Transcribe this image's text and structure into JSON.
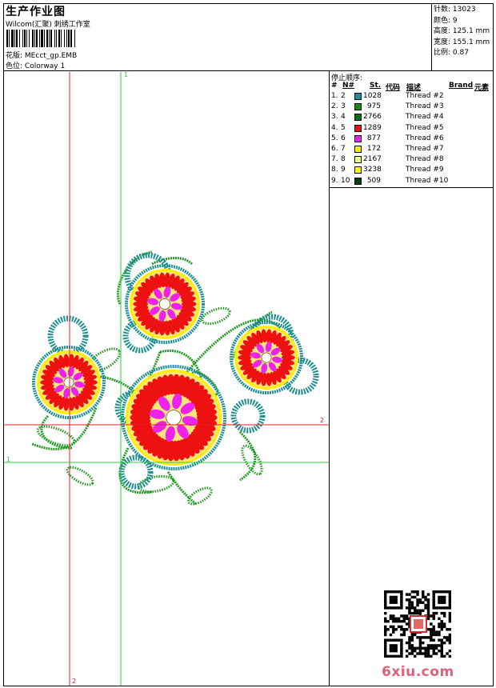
{
  "header": {
    "title": "生产作业图",
    "company": "Wilcom(汇聚) 刺绣工作室",
    "design_label": "花版:",
    "design_value": "MEcct_gp.EMB",
    "colorway_label": "色位:",
    "colorway_value": "Colorway 1"
  },
  "stats": [
    {
      "label": "针数:",
      "value": "13023"
    },
    {
      "label": "颜色:",
      "value": "9"
    },
    {
      "label": "高度:",
      "value": "125.1 mm"
    },
    {
      "label": "宽度:",
      "value": "155.1 mm"
    },
    {
      "label": "比例:",
      "value": "0.87"
    }
  ],
  "stop_sequence": {
    "title": "停止顺序:",
    "columns": {
      "stop": "#",
      "needle": "N#",
      "stitches": "St.",
      "code": "代码",
      "description": "描述",
      "brand": "Brand",
      "element": "元素"
    },
    "rows": [
      {
        "stop": "1.",
        "needle": "2",
        "color": "#1f8f8f",
        "stitches": "1028",
        "description": "Thread #2"
      },
      {
        "stop": "2.",
        "needle": "3",
        "color": "#1a8a1a",
        "stitches": "975",
        "description": "Thread #3"
      },
      {
        "stop": "3.",
        "needle": "4",
        "color": "#0f6e14",
        "stitches": "2766",
        "description": "Thread #4"
      },
      {
        "stop": "4.",
        "needle": "5",
        "color": "#ee1111",
        "stitches": "1289",
        "description": "Thread #5"
      },
      {
        "stop": "5.",
        "needle": "6",
        "color": "#ee22ee",
        "stitches": "877",
        "description": "Thread #6"
      },
      {
        "stop": "6.",
        "needle": "7",
        "color": "#ffee00",
        "stitches": "172",
        "description": "Thread #7"
      },
      {
        "stop": "7.",
        "needle": "8",
        "color": "#ffff88",
        "stitches": "2167",
        "description": "Thread #8"
      },
      {
        "stop": "8.",
        "needle": "9",
        "color": "#ffff00",
        "stitches": "3238",
        "description": "Thread #9"
      },
      {
        "stop": "9.",
        "needle": "10",
        "color": "#0b3d12",
        "stitches": "509",
        "description": "Thread #10"
      }
    ]
  },
  "guides": {
    "v1_label": "1",
    "v2_label": "2",
    "h1_label": "1",
    "h2_label": "2"
  },
  "watermark": "6xiu.com",
  "colors": {
    "guide_red": "#e0202a",
    "guide_green": "#2ecc40",
    "teal": "#1f8f8f",
    "green": "#1f9a1f",
    "red": "#ee1111",
    "magenta": "#ee22ee",
    "yellow": "#ffee00"
  }
}
